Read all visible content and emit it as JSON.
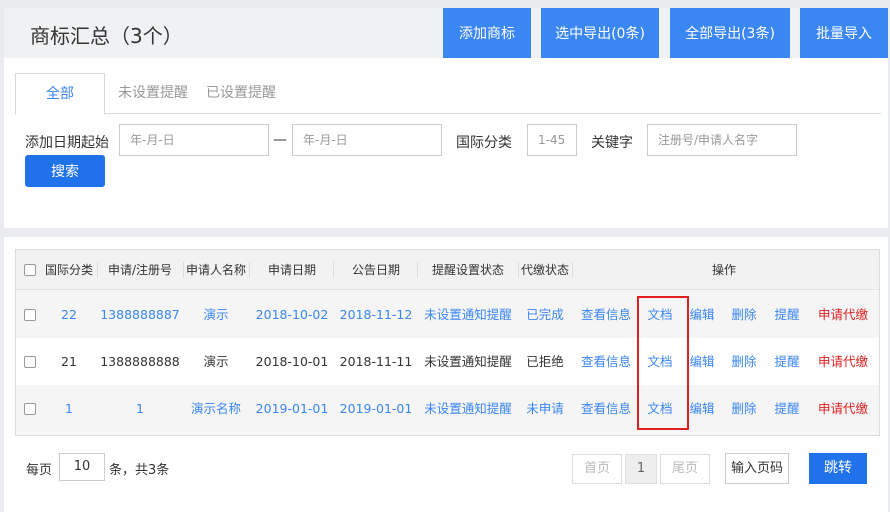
{
  "header": {
    "title": "商标汇总（3个）",
    "buttons": {
      "add": "添加商标",
      "export_selected": "选中导出(0条)",
      "export_all": "全部导出(3条)",
      "bulk_import": "批量导入"
    }
  },
  "tabs": [
    "全部",
    "未设置提醒",
    "已设置提醒"
  ],
  "active_tab": "全部",
  "filters": {
    "date_label": "添加日期起始",
    "date_from_placeholder": "年-月-日",
    "date_sep": "—",
    "date_to_placeholder": "年-月-日",
    "class_label": "国际分类",
    "class_placeholder": "1-45",
    "keyword_label": "关键字",
    "keyword_placeholder": "注册号/申请人名字",
    "search_button": "搜索"
  },
  "table": {
    "columns": [
      "国际分类",
      "申请/注册号",
      "申请人名称",
      "申请日期",
      "公告日期",
      "提醒设置状态",
      "代缴状态",
      "操作"
    ],
    "rows": [
      {
        "class": "22",
        "reg_no": "1388888887",
        "applicant": "演示",
        "apply_date": "2018-10-02",
        "notice_date": "2018-11-12",
        "reminder_status": "未设置通知提醒",
        "payment_status": "已完成",
        "style": "blue"
      },
      {
        "class": "21",
        "reg_no": "1388888888",
        "applicant": "演示",
        "apply_date": "2018-10-01",
        "notice_date": "2018-11-11",
        "reminder_status": "未设置通知提醒",
        "payment_status": "已拒绝",
        "style": "dark"
      },
      {
        "class": "1",
        "reg_no": "1",
        "applicant": "演示名称",
        "apply_date": "2019-01-01",
        "notice_date": "2019-01-01",
        "reminder_status": "未设置通知提醒",
        "payment_status": "未申请",
        "style": "blue"
      }
    ],
    "actions": [
      "查看信息",
      "文档",
      "编辑",
      "删除",
      "提醒",
      "申请代缴"
    ]
  },
  "pagination": {
    "per_page_label": "每页",
    "per_page_value": "10",
    "summary": "条，共3条",
    "first": "首页",
    "current": "1",
    "last": "尾页",
    "jump_placeholder": "输入页码",
    "jump_button": "跳转"
  },
  "colors": {
    "accent": "#3a86f3",
    "danger": "#e02020",
    "primary_button": "#1f72ea"
  }
}
